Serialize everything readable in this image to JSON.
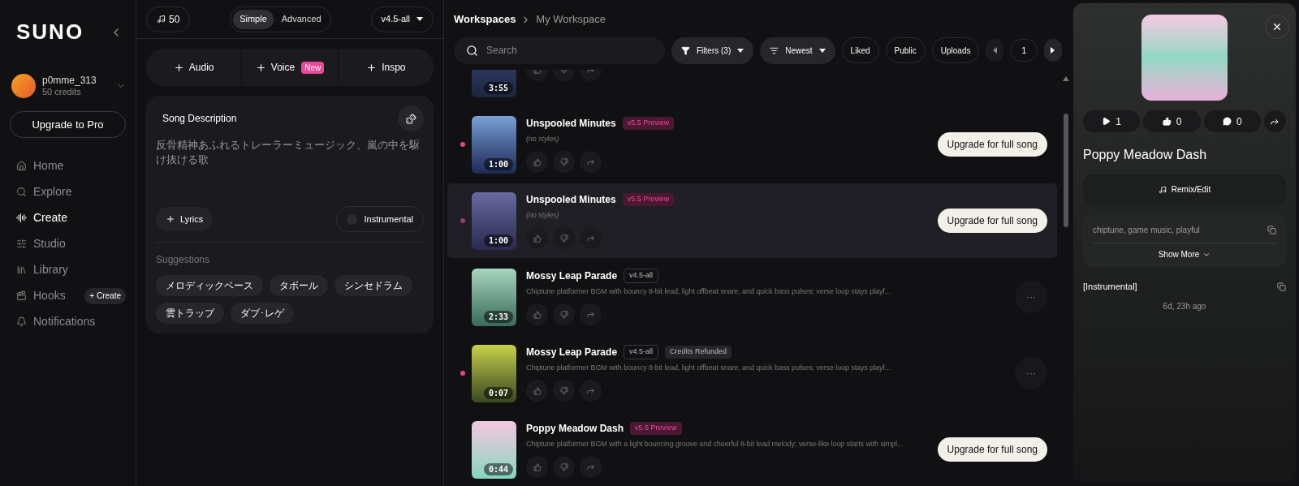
{
  "sidebar": {
    "logo": "SUNO",
    "user": {
      "name": "p0mme_313",
      "credits": "50 credits"
    },
    "upgrade": "Upgrade to Pro",
    "items": [
      {
        "label": "Home",
        "selected": false
      },
      {
        "label": "Explore",
        "selected": false
      },
      {
        "label": "Create",
        "selected": true
      },
      {
        "label": "Studio",
        "selected": false
      },
      {
        "label": "Library",
        "selected": false
      },
      {
        "label": "Hooks",
        "selected": false,
        "action": "+ Create"
      },
      {
        "label": "Notifications",
        "selected": false
      }
    ]
  },
  "create": {
    "credits": "50",
    "modes": [
      {
        "label": "Simple",
        "selected": true
      },
      {
        "label": "Advanced",
        "selected": false
      }
    ],
    "model": "v4.5-all",
    "adds": [
      {
        "label": "Audio"
      },
      {
        "label": "Voice",
        "badge": "New"
      },
      {
        "label": "Inspo"
      }
    ],
    "description": {
      "label": "Song Description",
      "value": "反骨精神あふれるトレーラーミュージック、嵐の中を駆け抜ける歌"
    },
    "lyrics": "Lyrics",
    "instrumental": {
      "label": "Instrumental",
      "on": false
    },
    "suggestions_label": "Suggestions",
    "suggestions": [
      "メロディックベース",
      "タボール",
      "シンセドラム",
      "雲トラップ",
      "ダブ･レゲ"
    ]
  },
  "workspace": {
    "breadcrumb": [
      "Workspaces",
      "My Workspace"
    ],
    "search": {
      "placeholder": "Search"
    },
    "filters": "Filters (3)",
    "sort": "Newest",
    "toggles": [
      "Liked",
      "Public",
      "Uploads"
    ],
    "page": "1",
    "songs": [
      {
        "duration": "3:55",
        "partial": true,
        "highlighted": false
      },
      {
        "title": "Unspooled Minutes",
        "duration": "1:00",
        "partial": false,
        "tags": [
          {
            "kind": "preview",
            "label": "v5.5 Preview"
          }
        ],
        "subtitle": "(no styles)",
        "italic": true,
        "color": "#e9458b",
        "button": {
          "kind": "upgrade",
          "label": "Upgrade for full song"
        },
        "highlighted": false
      },
      {
        "title": "Unspooled Minutes",
        "duration": "1:00",
        "partial": false,
        "tags": [
          {
            "kind": "preview",
            "label": "v5.5 Preview"
          }
        ],
        "subtitle": "(no styles)",
        "italic": true,
        "color": "#9c3a62",
        "button": {
          "kind": "upgrade",
          "label": "Upgrade for full song"
        },
        "highlighted": true
      },
      {
        "title": "Mossy Leap Parade",
        "duration": "2:33",
        "partial": false,
        "tags": [
          {
            "kind": "version",
            "label": "v4.5-all"
          }
        ],
        "subtitle": "Chiptune platformer BGM with bouncy 8-bit lead, light offbeat snare, and quick bass pulses; verse loop stays playf...",
        "italic": false,
        "button": {
          "kind": "more",
          "label": "···"
        },
        "highlighted": false
      },
      {
        "title": "Mossy Leap Parade",
        "duration": "0:07",
        "partial": false,
        "tags": [
          {
            "kind": "version",
            "label": "v4.5-all"
          },
          {
            "kind": "refunded",
            "label": "Credits Refunded"
          }
        ],
        "subtitle": "Chiptune platformer BGM with bouncy 8-bit lead, light offbeat snare, and quick bass pulses; verse loop stays playf...",
        "italic": false,
        "color": "#e9458b",
        "button": {
          "kind": "more",
          "label": "···"
        },
        "highlighted": false
      },
      {
        "title": "Poppy Meadow Dash",
        "duration": "0:44",
        "partial": false,
        "tags": [
          {
            "kind": "preview",
            "label": "v5.5 Preview"
          }
        ],
        "subtitle": "Chiptune platformer BGM with a light bouncing groove and cheerful 8-bit lead melody; verse-like loop starts with simpl...",
        "italic": false,
        "button": {
          "kind": "upgrade",
          "label": "Upgrade for full song"
        },
        "highlighted": false
      }
    ]
  },
  "detail": {
    "plays": "1",
    "likes": "0",
    "comments": "0",
    "title": "Poppy Meadow Dash",
    "remix": "Remix/Edit",
    "styles": "chiptune, game music, playful",
    "show_more": "Show More",
    "lyrics": "[Instrumental]",
    "age": "6d, 23h ago"
  }
}
